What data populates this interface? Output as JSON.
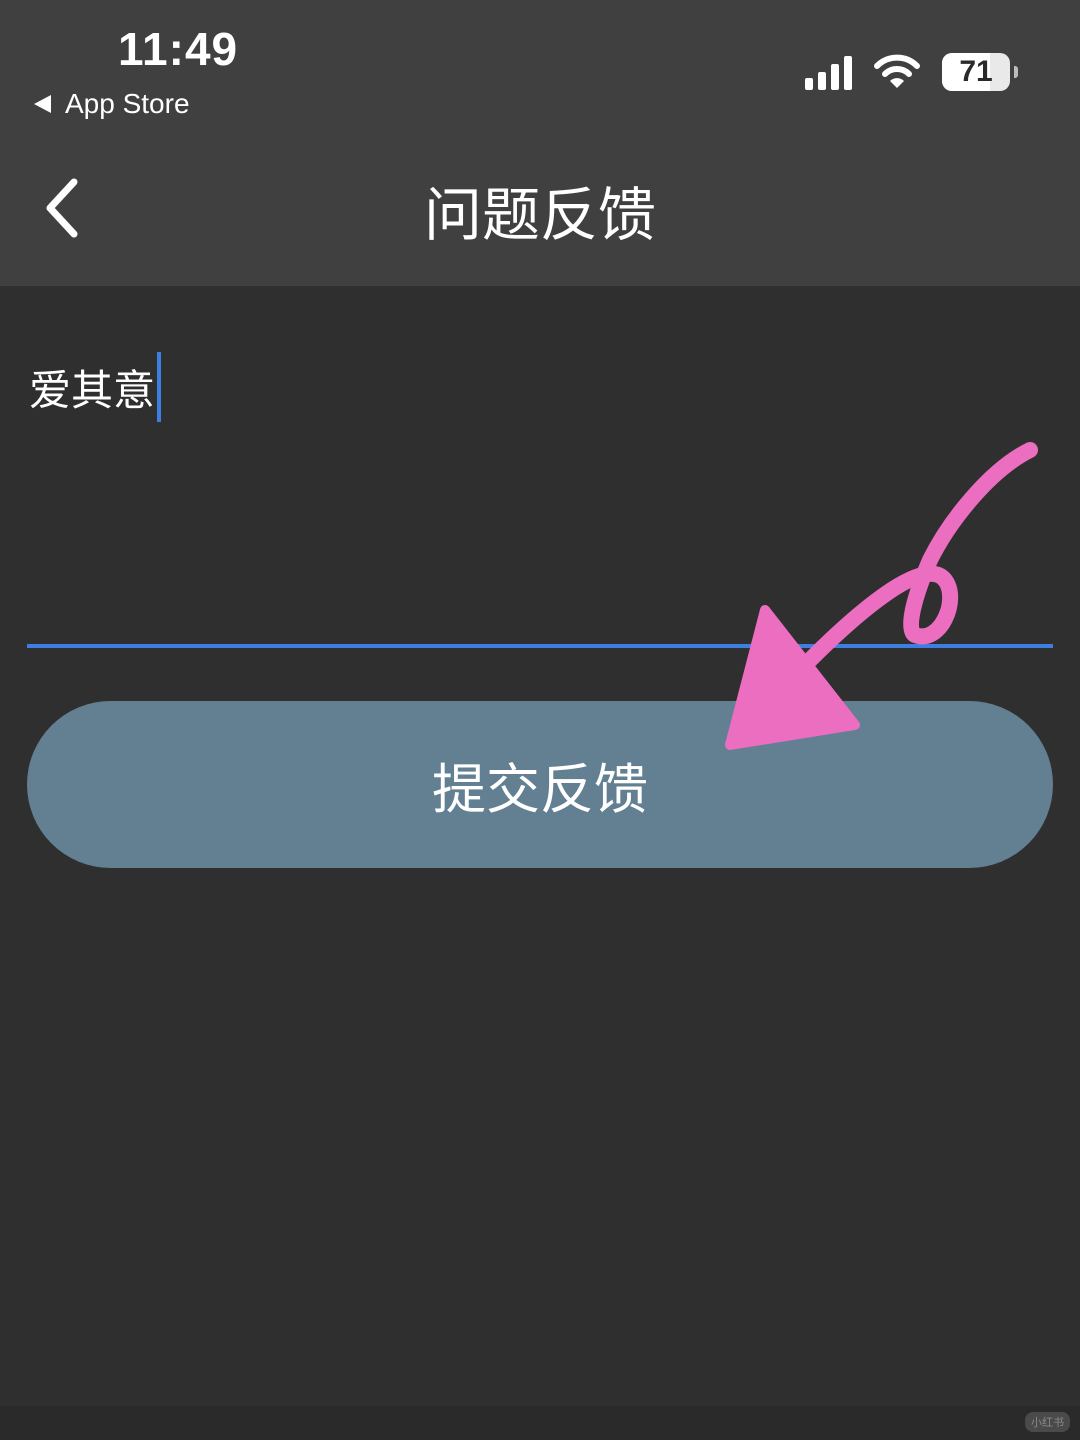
{
  "status_bar": {
    "time": "11:49",
    "back_to_app": "App Store",
    "battery": "71",
    "signal_icon": "cellular-signal-icon",
    "wifi_icon": "wifi-icon"
  },
  "nav": {
    "title": "问题反馈",
    "back_icon": "chevron-left-icon"
  },
  "feedback_input": {
    "value": "爱其意"
  },
  "submit_button": {
    "label": "提交反馈"
  },
  "annotation": {
    "type": "hand-drawn-arrow",
    "color": "#ec6ec1"
  },
  "watermark": {
    "text": "小红书"
  },
  "colors": {
    "accent": "#3d7fe0",
    "button": "#637f92",
    "header": "#404040",
    "background": "#2f2f2f"
  }
}
